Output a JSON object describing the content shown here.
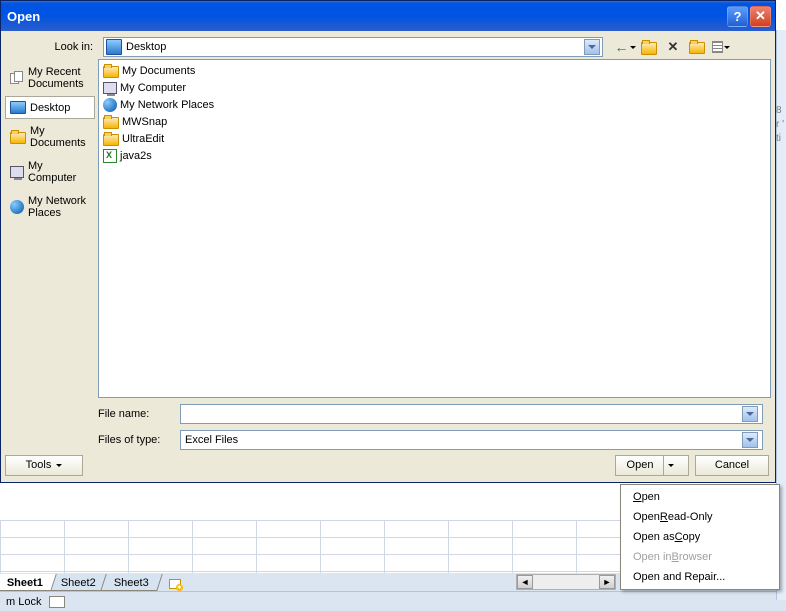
{
  "title": "Open",
  "lookin_label": "Look in:",
  "lookin_value": "Desktop",
  "places": [
    {
      "label": "My Recent Documents",
      "icon": "docs"
    },
    {
      "label": "Desktop",
      "icon": "desktop",
      "selected": true
    },
    {
      "label": "My Documents",
      "icon": "folder"
    },
    {
      "label": "My Computer",
      "icon": "mycomp"
    },
    {
      "label": "My Network Places",
      "icon": "net"
    }
  ],
  "files": [
    {
      "name": "My Documents",
      "icon": "folder"
    },
    {
      "name": "My Computer",
      "icon": "mycomp"
    },
    {
      "name": "My Network Places",
      "icon": "net"
    },
    {
      "name": "MWSnap",
      "icon": "folder"
    },
    {
      "name": "UltraEdit",
      "icon": "folder"
    },
    {
      "name": "java2s",
      "icon": "xls"
    }
  ],
  "filename_label": "File name:",
  "filename_value": "",
  "filetype_label": "Files of type:",
  "filetype_value": "Excel Files",
  "tools_label": "Tools",
  "open_label": "Open",
  "cancel_label": "Cancel",
  "open_menu": [
    {
      "label": "Open",
      "u": "O",
      "enabled": true
    },
    {
      "label": "Open Read-Only",
      "u": "R",
      "enabled": true
    },
    {
      "label": "Open as Copy",
      "u": "C",
      "enabled": true
    },
    {
      "label": "Open in Browser",
      "u": "B",
      "enabled": false
    },
    {
      "label": "Open and Repair...",
      "u": "",
      "enabled": true
    }
  ],
  "sheets": [
    "Sheet1",
    "Sheet2",
    "Sheet3"
  ],
  "active_sheet": 0,
  "status_text": "m Lock",
  "edge_hint": "8\nr '\nti"
}
